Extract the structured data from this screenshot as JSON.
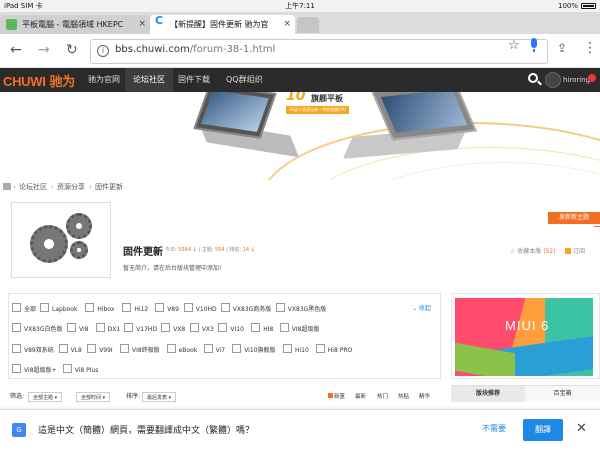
{
  "status": {
    "carrier": "iPad SIM 卡",
    "time": "上午7:11",
    "battery": "100%"
  },
  "tabs": [
    {
      "title": "平板電腦 - 電腦領域 HKEPC"
    },
    {
      "title": "【新提醒】固件更新 驰为官"
    }
  ],
  "address": {
    "host": "bbs.chuwi.com",
    "path": "/forum-38-1.html"
  },
  "icons": {
    "back": "←",
    "forward": "→",
    "reload": "↻",
    "info": "i",
    "star": "☆",
    "share": "⇪",
    "menu": "⋮",
    "tab_close": "×",
    "close": "✕"
  },
  "site": {
    "logo_brand": "CHUWI",
    "logo_zh": "驰为",
    "nav": [
      "驰为官网",
      "论坛社区",
      "固件下载",
      "QQ群组织"
    ],
    "active_nav": 1,
    "username": "hiroring",
    "brand_color": "#f26f21"
  },
  "banner": {
    "num": "10",
    "title": "旗舰平板",
    "sub": "18英寸高清全新一代处理器CPU"
  },
  "breadcrumb": [
    "论坛社区",
    "资源分享",
    "固件更新"
  ],
  "breadcrumb_sep": "›",
  "forum": {
    "title": "固件更新",
    "today_label": "今日:",
    "today": "5564",
    "topics_label": "主题:",
    "topics": "554",
    "rank_label": "排名:",
    "rank": "14",
    "sep": "|",
    "arrow": "↓",
    "desc": "暂无简介，请在后台版块管理中添加!",
    "fav_label": "收藏本版",
    "fav_count": "(52)",
    "rss": "订阅",
    "new_post": "发新新主题"
  },
  "tags": [
    [
      "全部",
      "Lapbook",
      "Hibox",
      "Hi12",
      "V89",
      "V10HD",
      "VX83G商务版",
      "VX83G黑色版"
    ],
    [
      "VX83G白色版",
      "Vi8",
      "DX1",
      "V17HD",
      "VX8",
      "VX3",
      "VI10",
      "HI8",
      "VI8超级版"
    ],
    [
      "V89双系统",
      "VL8",
      "V99I",
      "VI8终极版",
      "eBook",
      "Vi7",
      "Vi10旗舰版",
      "Hi10",
      "Hi8 PRO"
    ],
    [
      "Vi8超级版+",
      "Vi8 Plus"
    ]
  ],
  "collapse_label": "⌄ 收起",
  "filter": {
    "label": "筛选:",
    "s1": "全部主题 ▾",
    "s2": "全部时间 ▾",
    "sort_label": "排序:",
    "s3": "最后发表 ▾",
    "opts": [
      "新篮",
      "最新",
      "热门",
      "热贴",
      "精华"
    ]
  },
  "ad": {
    "title": "MIUI 6"
  },
  "sidetabs": [
    "版块推荐",
    "百宝箱"
  ],
  "translate": {
    "prompt": "這是中文（簡體）網頁，需要翻譯成中文（繁體）嗎？",
    "no": "不需要",
    "yes": "翻譯",
    "icon": "G"
  }
}
